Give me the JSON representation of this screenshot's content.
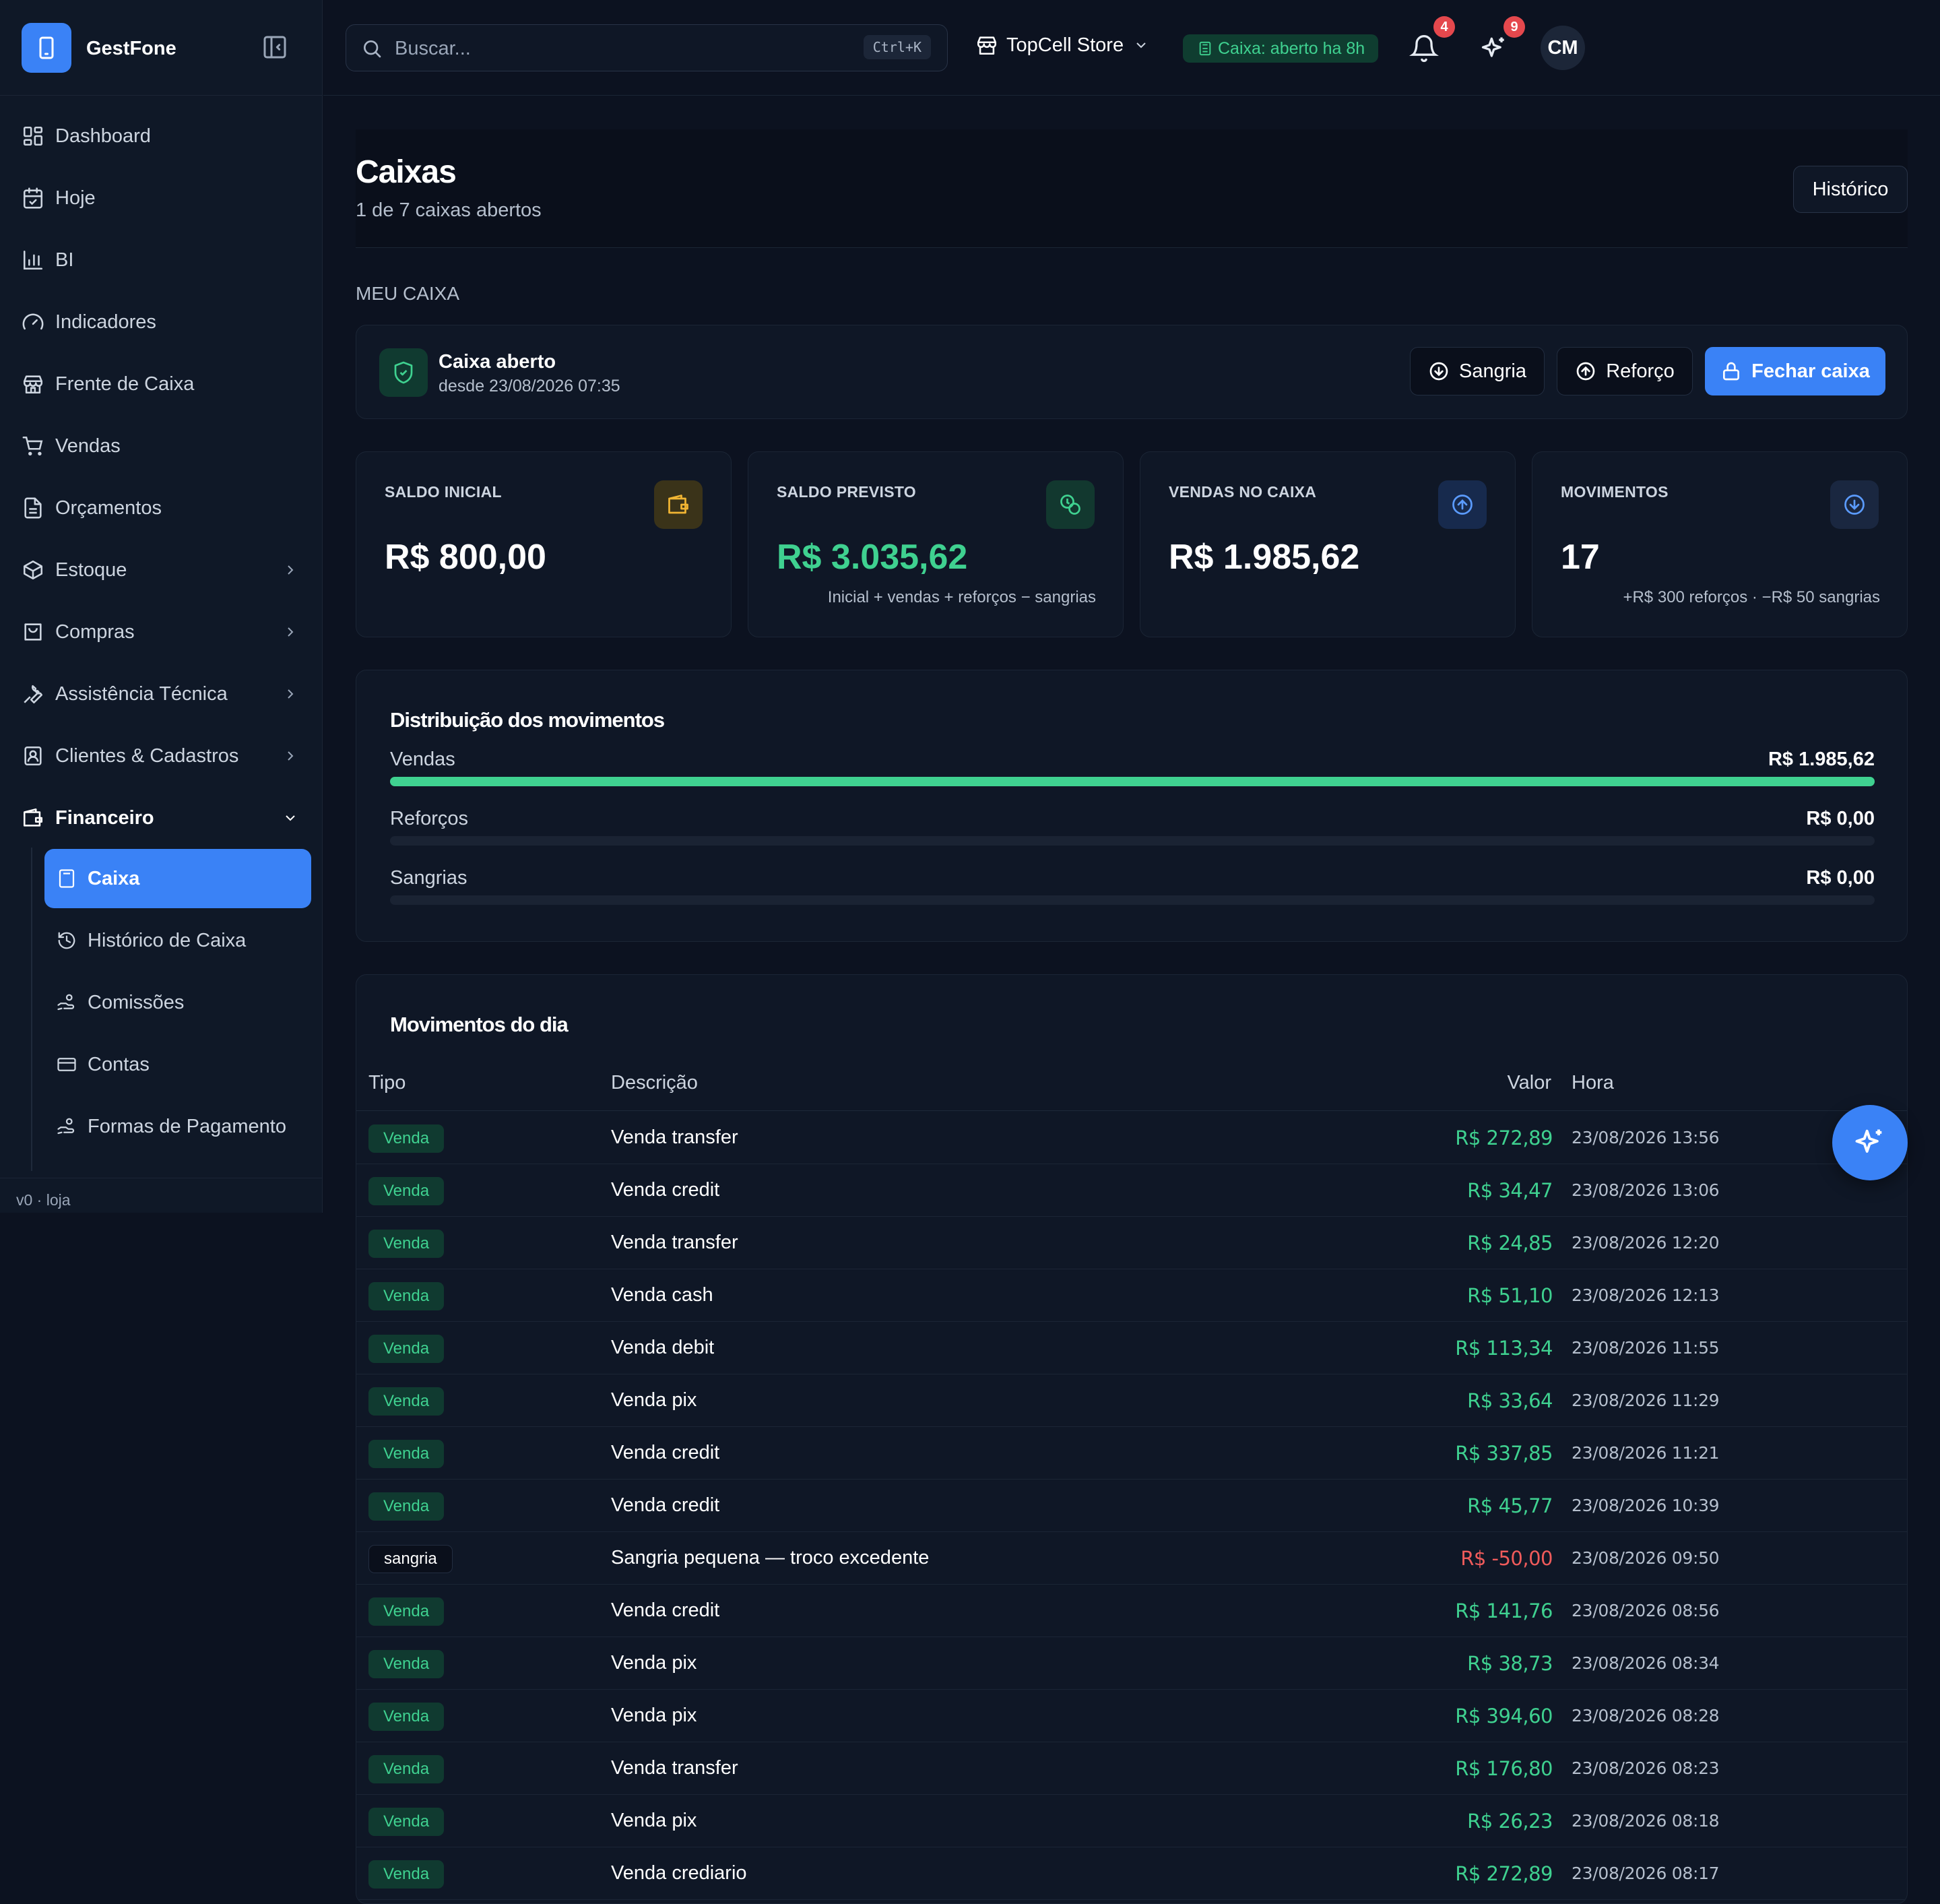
{
  "app": {
    "name": "GestFone",
    "version": "v0 · loja"
  },
  "colors": {
    "accent": "#3a82f6",
    "positive": "#3fd190",
    "negative": "#ef5b5b",
    "background": "#0c1220"
  },
  "topbar": {
    "search_placeholder": "Buscar...",
    "search_shortcut": "Ctrl+K",
    "store": "TopCell Store",
    "caixa_status": "Caixa: aberto ha 8h",
    "notifications_count": "4",
    "ai_count": "9",
    "user_initials": "CM"
  },
  "sidebar": {
    "items": [
      {
        "label": "Dashboard",
        "icon": "dashboard-icon"
      },
      {
        "label": "Hoje",
        "icon": "calendar-icon"
      },
      {
        "label": "BI",
        "icon": "bar-chart-icon"
      },
      {
        "label": "Indicadores",
        "icon": "gauge-icon"
      },
      {
        "label": "Frente de Caixa",
        "icon": "store-icon"
      },
      {
        "label": "Vendas",
        "icon": "cart-icon"
      },
      {
        "label": "Orçamentos",
        "icon": "document-icon"
      },
      {
        "label": "Estoque",
        "icon": "box-icon"
      },
      {
        "label": "Compras",
        "icon": "bag-icon"
      },
      {
        "label": "Assistência Técnica",
        "icon": "wrench-icon"
      },
      {
        "label": "Clientes & Cadastros",
        "icon": "contacts-icon"
      },
      {
        "label": "Financeiro",
        "icon": "wallet-icon"
      }
    ],
    "financeiro_sub": [
      {
        "label": "Caixa",
        "icon": "calculator-icon"
      },
      {
        "label": "Histórico de Caixa",
        "icon": "history-icon"
      },
      {
        "label": "Comissões",
        "icon": "handcoins-icon"
      },
      {
        "label": "Contas",
        "icon": "credit-card-icon"
      },
      {
        "label": "Formas de Pagamento",
        "icon": "handcoins-icon"
      }
    ]
  },
  "page": {
    "title": "Caixas",
    "subtitle": "1 de 7 caixas abertos",
    "history_button": "Histórico",
    "section_label": "MEU CAIXA"
  },
  "status": {
    "title": "Caixa aberto",
    "since": "desde 23/08/2026 07:35",
    "sangria_button": "Sangria",
    "reforco_button": "Reforço",
    "fechar_button": "Fechar caixa"
  },
  "stats": [
    {
      "label": "SALDO INICIAL",
      "value": "R$ 800,00",
      "note": ""
    },
    {
      "label": "SALDO PREVISTO",
      "value": "R$ 3.035,62",
      "note": "Inicial + vendas + reforços − sangrias"
    },
    {
      "label": "VENDAS NO CAIXA",
      "value": "R$ 1.985,62",
      "note": ""
    },
    {
      "label": "MOVIMENTOS",
      "value": "17",
      "note": "+R$ 300 reforços · −R$ 50 sangrias"
    }
  ],
  "distribution": {
    "title": "Distribuição dos movimentos",
    "rows": [
      {
        "label": "Vendas",
        "value": "R$ 1.985,62",
        "fraction": 1.0
      },
      {
        "label": "Reforços",
        "value": "R$ 0,00",
        "fraction": 0
      },
      {
        "label": "Sangrias",
        "value": "R$ 0,00",
        "fraction": 0
      }
    ]
  },
  "movements": {
    "title": "Movimentos do dia",
    "columns": {
      "tipo": "Tipo",
      "descricao": "Descrição",
      "valor": "Valor",
      "hora": "Hora"
    },
    "rows": [
      {
        "tipo": "Venda",
        "descricao": "Venda transfer",
        "valor": "R$ 272,89",
        "hora": "23/08/2026 13:56"
      },
      {
        "tipo": "Venda",
        "descricao": "Venda credit",
        "valor": "R$ 34,47",
        "hora": "23/08/2026 13:06"
      },
      {
        "tipo": "Venda",
        "descricao": "Venda transfer",
        "valor": "R$ 24,85",
        "hora": "23/08/2026 12:20"
      },
      {
        "tipo": "Venda",
        "descricao": "Venda cash",
        "valor": "R$ 51,10",
        "hora": "23/08/2026 12:13"
      },
      {
        "tipo": "Venda",
        "descricao": "Venda debit",
        "valor": "R$ 113,34",
        "hora": "23/08/2026 11:55"
      },
      {
        "tipo": "Venda",
        "descricao": "Venda pix",
        "valor": "R$ 33,64",
        "hora": "23/08/2026 11:29"
      },
      {
        "tipo": "Venda",
        "descricao": "Venda credit",
        "valor": "R$ 337,85",
        "hora": "23/08/2026 11:21"
      },
      {
        "tipo": "Venda",
        "descricao": "Venda credit",
        "valor": "R$ 45,77",
        "hora": "23/08/2026 10:39"
      },
      {
        "tipo": "sangria",
        "descricao": "Sangria pequena — troco excedente",
        "valor": "R$ -50,00",
        "hora": "23/08/2026 09:50"
      },
      {
        "tipo": "Venda",
        "descricao": "Venda credit",
        "valor": "R$ 141,76",
        "hora": "23/08/2026 08:56"
      },
      {
        "tipo": "Venda",
        "descricao": "Venda pix",
        "valor": "R$ 38,73",
        "hora": "23/08/2026 08:34"
      },
      {
        "tipo": "Venda",
        "descricao": "Venda pix",
        "valor": "R$ 394,60",
        "hora": "23/08/2026 08:28"
      },
      {
        "tipo": "Venda",
        "descricao": "Venda transfer",
        "valor": "R$ 176,80",
        "hora": "23/08/2026 08:23"
      },
      {
        "tipo": "Venda",
        "descricao": "Venda pix",
        "valor": "R$ 26,23",
        "hora": "23/08/2026 08:18"
      },
      {
        "tipo": "Venda",
        "descricao": "Venda crediario",
        "valor": "R$ 272,89",
        "hora": "23/08/2026 08:17"
      }
    ]
  }
}
